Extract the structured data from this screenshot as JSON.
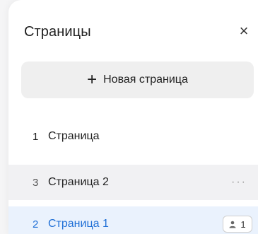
{
  "panel": {
    "title": "Страницы",
    "close_icon": "close-icon",
    "new_page_label": "Новая страница",
    "plus_icon": "plus-icon"
  },
  "pages": [
    {
      "number": "1",
      "name": "Страница",
      "state": "default"
    },
    {
      "number": "3",
      "name": "Страница 2",
      "state": "hover",
      "more_icon": "more-icon"
    },
    {
      "number": "2",
      "name": "Страница 1",
      "state": "selected",
      "viewers_count": "1",
      "viewer_icon": "user-icon"
    }
  ],
  "colors": {
    "accent": "#1f6fd6",
    "selected_bg": "#eaf2fd",
    "hover_bg": "#f1f1f3",
    "button_bg": "#efefef"
  }
}
